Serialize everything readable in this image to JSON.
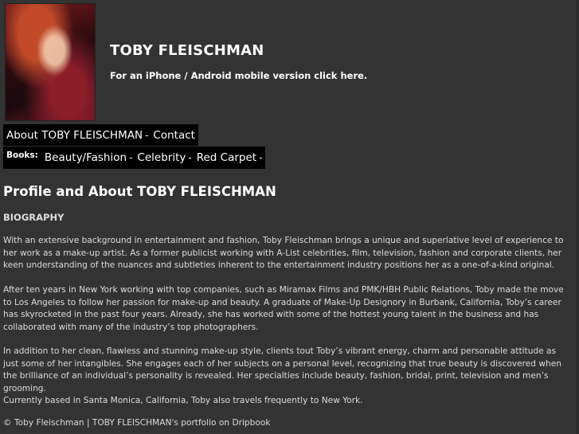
{
  "header": {
    "title": "TOBY FLEISCHMAN",
    "mobile_text": "For an iPhone / Android mobile version click here."
  },
  "nav": {
    "primary": [
      {
        "label": "About TOBY FLEISCHMAN"
      },
      {
        "label": "Contact"
      }
    ],
    "books_label": "Books:",
    "books": [
      {
        "label": "Beauty/Fashion"
      },
      {
        "label": "Celebrity"
      },
      {
        "label": "Red Carpet"
      }
    ],
    "separator": "-"
  },
  "main": {
    "heading": "Profile and About TOBY FLEISCHMAN",
    "section": "BIOGRAPHY",
    "paragraphs": [
      "With an extensive background in entertainment and fashion, Toby Fleischman brings a unique and superlative level of experience to her work as a make-up artist. As a former publicist working with A-List celebrities, film, television, fashion and corporate clients, her keen understanding of the nuances and subtleties inherent to the entertainment industry positions her as a one-of-a-kind original.",
      "After ten years in New York working with top companies, such as Miramax Films and PMK/HBH Public Relations, Toby made the move to Los Angeles to follow her passion for make-up and beauty. A graduate of Make-Up Designory in Burbank, California, Toby’s career has skyrocketed in the past four years. Already, she has worked with some of the hottest young talent in the business and has collaborated with many of the industry’s top photographers.",
      "In addition to her clean, flawless and stunning make-up style, clients tout Toby’s vibrant energy, charm and personable attitude as just some of her intangibles. She engages each of her subjects on a personal level, recognizing that true beauty is discovered when the brilliance of an individual’s personality is revealed. Her specialties include beauty, fashion, bridal, print, television and men’s grooming.",
      "Currently based in Santa Monica, California, Toby also travels frequently to New York."
    ]
  },
  "footer": {
    "copyright": "© Toby Fleischman",
    "divider": "|",
    "portfolio_link": "TOBY FLEISCHMAN's portfolio on Dripbook"
  }
}
